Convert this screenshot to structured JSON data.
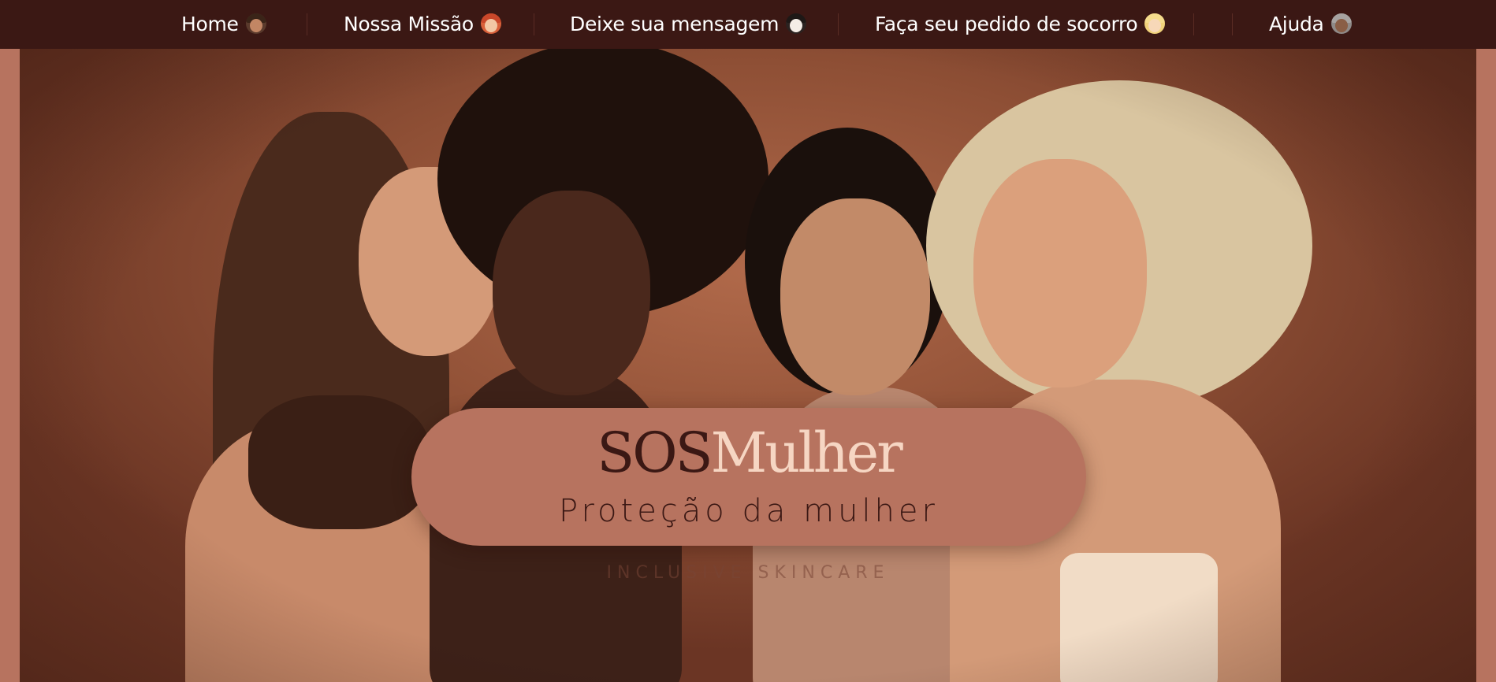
{
  "nav": {
    "items": [
      {
        "label": "Home",
        "icon": "woman-dark-hair-emoji-icon"
      },
      {
        "label": "Nossa Missão",
        "icon": "woman-red-hair-emoji-icon"
      },
      {
        "label": "Deixe sua mensagem",
        "icon": "woman-curly-hair-emoji-icon"
      },
      {
        "label": "Faça seu pedido de socorro",
        "icon": "woman-blonde-hair-emoji-icon"
      },
      {
        "label": "Ajuda",
        "icon": "woman-gray-hair-emoji-icon"
      }
    ]
  },
  "hero": {
    "brand_part1": "SOS",
    "brand_part2": "Mulher",
    "tagline": "Proteção da mulher",
    "watermark": "INCLUSIVE SKINCARE"
  },
  "colors": {
    "nav_background": "#3b1814",
    "page_background": "#b7735f",
    "brand_dark": "#3b1814",
    "brand_light": "#f6d6c3"
  }
}
